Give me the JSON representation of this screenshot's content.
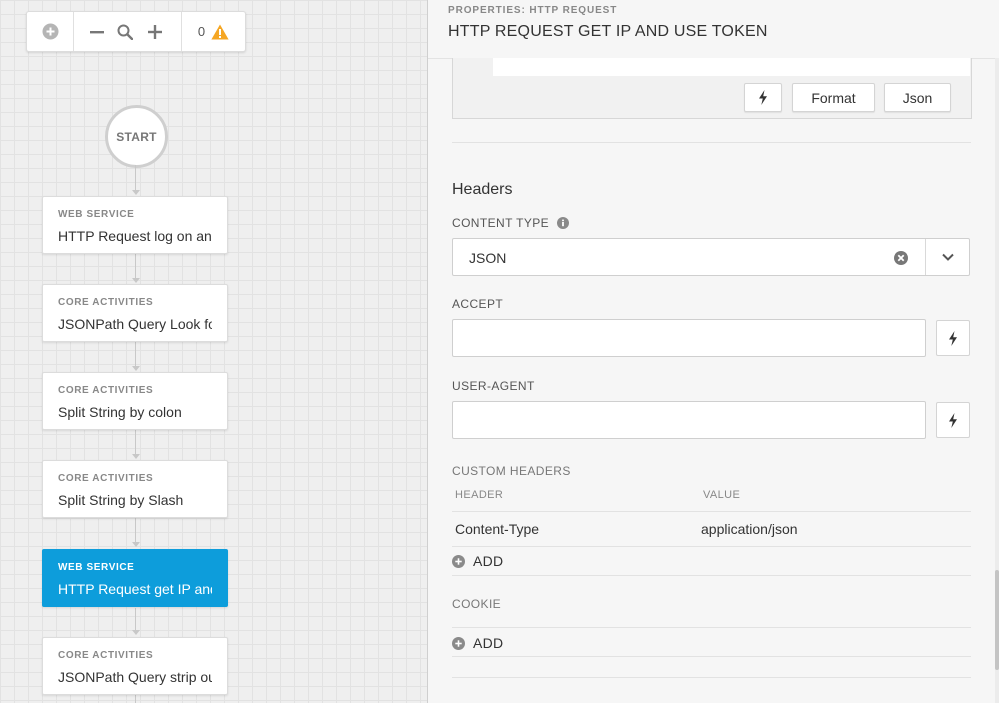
{
  "toolbar": {
    "warning_count": "0"
  },
  "flow": {
    "start_label": "START",
    "nodes": [
      {
        "category": "WEB SERVICE",
        "name": "HTTP Request log on and ..."
      },
      {
        "category": "CORE ACTIVITIES",
        "name": "JSONPath Query Look for..."
      },
      {
        "category": "CORE ACTIVITIES",
        "name": "Split String by colon"
      },
      {
        "category": "CORE ACTIVITIES",
        "name": "Split String by Slash"
      },
      {
        "category": "WEB SERVICE",
        "name": "HTTP Request get IP and ..."
      },
      {
        "category": "CORE ACTIVITIES",
        "name": "JSONPath Query strip ou..."
      }
    ],
    "selected_index": 4
  },
  "panel": {
    "kicker": "PROPERTIES: HTTP REQUEST",
    "title": "HTTP REQUEST GET IP AND USE TOKEN",
    "editor_buttons": {
      "format": "Format",
      "json": "Json"
    },
    "headers_title": "Headers",
    "content_type": {
      "label": "CONTENT TYPE",
      "value": "JSON"
    },
    "accept": {
      "label": "ACCEPT",
      "value": ""
    },
    "user_agent": {
      "label": "USER-AGENT",
      "value": ""
    },
    "custom_headers": {
      "label": "CUSTOM HEADERS",
      "columns": [
        "HEADER",
        "VALUE"
      ],
      "rows": [
        {
          "header": "Content-Type",
          "value": "application/json"
        }
      ],
      "add_label": "ADD"
    },
    "cookie": {
      "label": "COOKIE",
      "add_label": "ADD"
    }
  },
  "colors": {
    "accent": "#0d9ddb",
    "warning": "#f5a623"
  }
}
